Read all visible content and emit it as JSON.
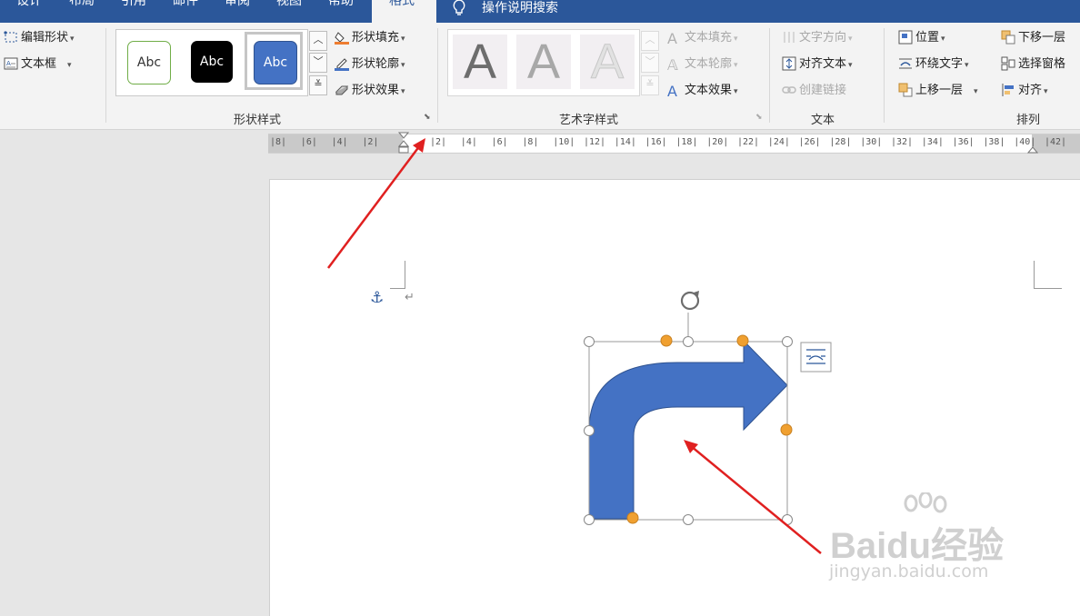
{
  "tabs": [
    "设计",
    "布局",
    "引用",
    "邮件",
    "审阅",
    "视图",
    "帮助",
    "格式"
  ],
  "active_tab": "格式",
  "tell_me": "操作说明搜索",
  "insert_shapes": {
    "edit_shape": "编辑形状",
    "text_box": "文本框"
  },
  "shape_styles": {
    "label": "形状样式",
    "presets": [
      "Abc",
      "Abc",
      "Abc"
    ],
    "fill": "形状填充",
    "outline": "形状轮廓",
    "effects": "形状效果"
  },
  "wordart": {
    "label": "艺术字样式",
    "letters": [
      "A",
      "A",
      "A"
    ],
    "text_fill": "文本填充",
    "text_outline": "文本轮廓",
    "text_effects": "文本效果"
  },
  "text_group": {
    "label": "文本",
    "direction": "文字方向",
    "align_text": "对齐文本",
    "create_link": "创建链接"
  },
  "arrange": {
    "label": "排列",
    "position": "位置",
    "wrap_text": "环绕文字",
    "bring_forward": "上移一层",
    "send_backward": "下移一层",
    "selection_pane": "选择窗格",
    "align": "对齐"
  },
  "ruler": {
    "left_labels": [
      "8",
      "6",
      "4",
      "2"
    ],
    "right_labels": [
      "2",
      "4",
      "6",
      "8",
      "10",
      "12",
      "14",
      "16",
      "18",
      "20",
      "22",
      "24",
      "26",
      "28",
      "30",
      "32",
      "34",
      "36",
      "38",
      "40",
      "42"
    ]
  },
  "document": {
    "anchor_symbol": "⚓",
    "paragraph_mark": "↵"
  },
  "watermark": {
    "brand": "Baidu经验",
    "url": "jingyan.baidu.com"
  },
  "colors": {
    "tab_bar": "#2b579a",
    "shape_fill": "#4472c4",
    "annotation_arrow": "#e02020",
    "handle_yellow": "#f0a030"
  }
}
